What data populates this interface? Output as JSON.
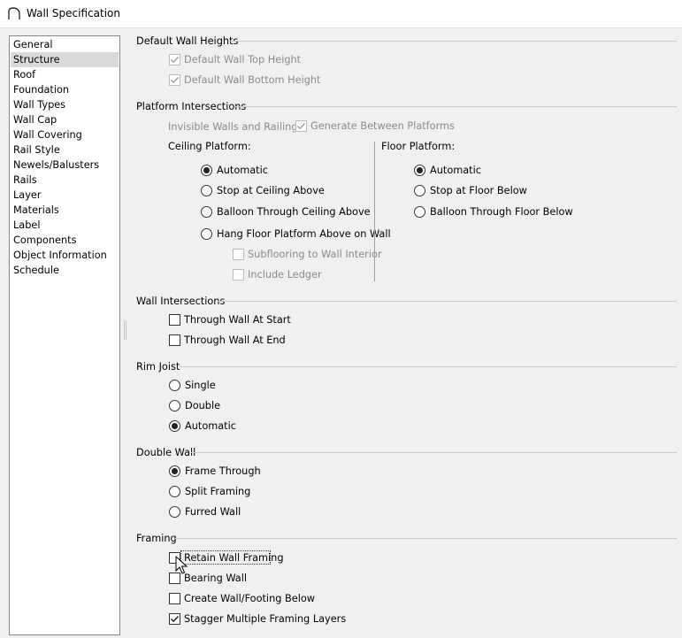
{
  "window": {
    "title": "Wall Specification"
  },
  "nav": {
    "items": [
      {
        "label": "General",
        "selected": false
      },
      {
        "label": "Structure",
        "selected": true
      },
      {
        "label": "Roof",
        "selected": false
      },
      {
        "label": "Foundation",
        "selected": false
      },
      {
        "label": "Wall Types",
        "selected": false
      },
      {
        "label": "Wall Cap",
        "selected": false
      },
      {
        "label": "Wall Covering",
        "selected": false
      },
      {
        "label": "Rail Style",
        "selected": false
      },
      {
        "label": "Newels/Balusters",
        "selected": false
      },
      {
        "label": "Rails",
        "selected": false
      },
      {
        "label": "Layer",
        "selected": false
      },
      {
        "label": "Materials",
        "selected": false
      },
      {
        "label": "Label",
        "selected": false
      },
      {
        "label": "Components",
        "selected": false
      },
      {
        "label": "Object Information",
        "selected": false
      },
      {
        "label": "Schedule",
        "selected": false
      }
    ]
  },
  "heights": {
    "title": "Default Wall Heights",
    "top": {
      "label": "Default Wall Top Height",
      "checked": true,
      "disabled": true
    },
    "bottom": {
      "label": "Default Wall Bottom Height",
      "checked": true,
      "disabled": true
    }
  },
  "platform": {
    "title": "Platform Intersections",
    "invisible_label": "Invisible Walls and Railings:",
    "generate": {
      "label": "Generate Between Platforms",
      "checked": true,
      "disabled": true
    },
    "ceiling": {
      "title": "Ceiling Platform:",
      "automatic": {
        "label": "Automatic",
        "selected": true
      },
      "stop": {
        "label": "Stop at Ceiling Above",
        "selected": false
      },
      "balloon": {
        "label": "Balloon Through Ceiling Above",
        "selected": false
      },
      "hang": {
        "label": "Hang Floor Platform Above on Wall",
        "selected": false
      },
      "subflooring": {
        "label": "Subflooring to Wall Interior",
        "checked": false,
        "disabled": true
      },
      "ledger": {
        "label": "Include Ledger",
        "checked": false,
        "disabled": true
      }
    },
    "floor": {
      "title": "Floor Platform:",
      "automatic": {
        "label": "Automatic",
        "selected": true
      },
      "stop": {
        "label": "Stop at Floor Below",
        "selected": false
      },
      "balloon": {
        "label": "Balloon Through Floor Below",
        "selected": false
      }
    }
  },
  "intersections": {
    "title": "Wall Intersections",
    "start": {
      "label": "Through Wall At Start",
      "checked": false
    },
    "end": {
      "label": "Through Wall At End",
      "checked": false
    }
  },
  "rim_joist": {
    "title": "Rim Joist",
    "single": {
      "label": "Single",
      "selected": false
    },
    "double": {
      "label": "Double",
      "selected": false
    },
    "automatic": {
      "label": "Automatic",
      "selected": true
    }
  },
  "double_wall": {
    "title": "Double Wall",
    "frame_through": {
      "label": "Frame Through",
      "selected": true
    },
    "split": {
      "label": "Split Framing",
      "selected": false
    },
    "furred": {
      "label": "Furred Wall",
      "selected": false
    }
  },
  "framing": {
    "title": "Framing",
    "retain": {
      "label": "Retain Wall Framing",
      "checked": false
    },
    "bearing": {
      "label": "Bearing Wall",
      "checked": false
    },
    "create_footing": {
      "label": "Create Wall/Footing Below",
      "checked": false
    },
    "stagger": {
      "label": "Stagger Multiple Framing Layers",
      "checked": true
    }
  }
}
